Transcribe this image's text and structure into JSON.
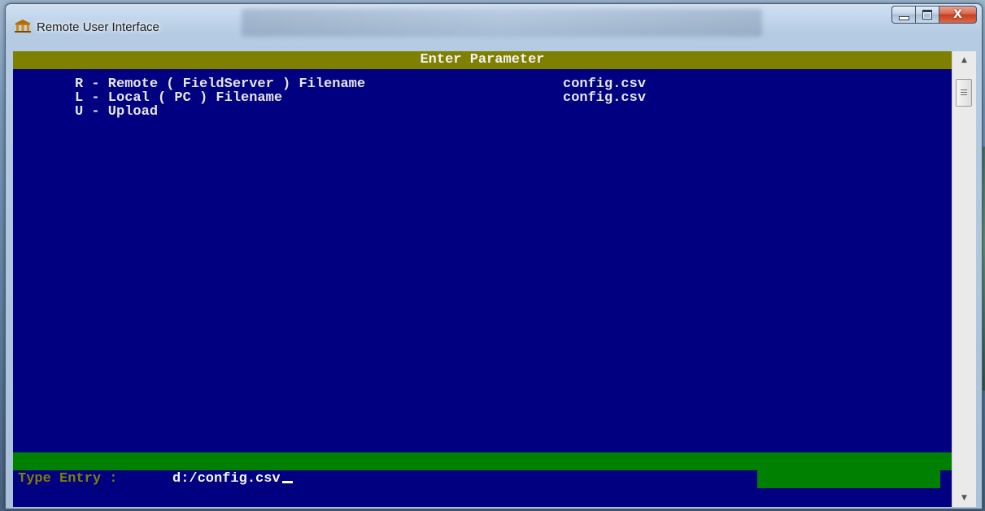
{
  "window": {
    "title": "Remote User Interface",
    "app_icon": "building-columns-icon",
    "controls": {
      "minimize_icon": "minimize-icon",
      "maximize_icon": "maximize-icon",
      "close_icon": "close-icon",
      "close_label": "X"
    }
  },
  "console": {
    "header": "Enter Parameter",
    "menu": [
      {
        "text": "R - Remote ( FieldServer ) Filename",
        "value": "config.csv"
      },
      {
        "text": "L - Local ( PC ) Filename",
        "value": "config.csv"
      },
      {
        "text": "U - Upload",
        "value": ""
      }
    ],
    "entry": {
      "label": "Type Entry : ",
      "value": "d:/config.csv"
    }
  },
  "scrollbar": {
    "up_icon": "scroll-up-arrow-icon",
    "down_icon": "scroll-down-arrow-icon",
    "up_glyph": "▲",
    "down_glyph": "▼"
  },
  "colors": {
    "console_background": "#000080",
    "header_bar": "#808000",
    "status_bar": "#008000",
    "entry_label": "#808000"
  }
}
